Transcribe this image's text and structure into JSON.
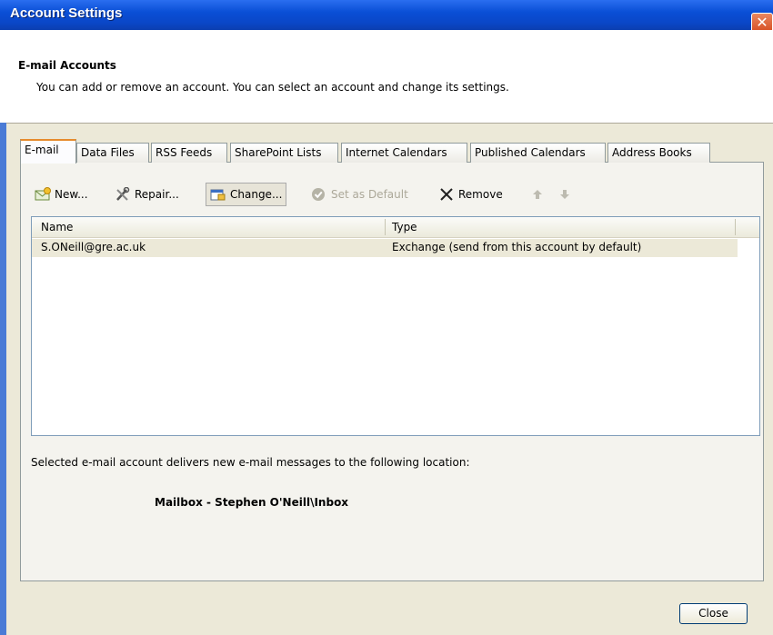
{
  "window": {
    "title": "Account Settings",
    "close_glyph": "✕"
  },
  "header": {
    "title": "E-mail Accounts",
    "description": "You can add or remove an account. You can select an account and change its settings."
  },
  "tabs": [
    {
      "label": "E-mail",
      "active": true
    },
    {
      "label": "Data Files"
    },
    {
      "label": "RSS Feeds"
    },
    {
      "label": "SharePoint Lists"
    },
    {
      "label": "Internet Calendars"
    },
    {
      "label": "Published Calendars"
    },
    {
      "label": "Address Books"
    }
  ],
  "toolbar": {
    "new_label": "New...",
    "repair_label": "Repair...",
    "change_label": "Change...",
    "set_default_label": "Set as Default",
    "remove_label": "Remove"
  },
  "accounts": {
    "columns": {
      "name": "Name",
      "type": "Type"
    },
    "rows": [
      {
        "name": "S.ONeill@gre.ac.uk",
        "type": "Exchange (send from this account by default)"
      }
    ]
  },
  "delivery": {
    "info": "Selected e-mail account delivers new e-mail messages to the following location:",
    "location": "Mailbox - Stephen O'Neill\\Inbox"
  },
  "footer": {
    "close_label": "Close"
  },
  "colors": {
    "titlebar": "#0a4fd6",
    "accent_tab": "#e68b2c",
    "dialog_bg": "#ece9d8"
  }
}
